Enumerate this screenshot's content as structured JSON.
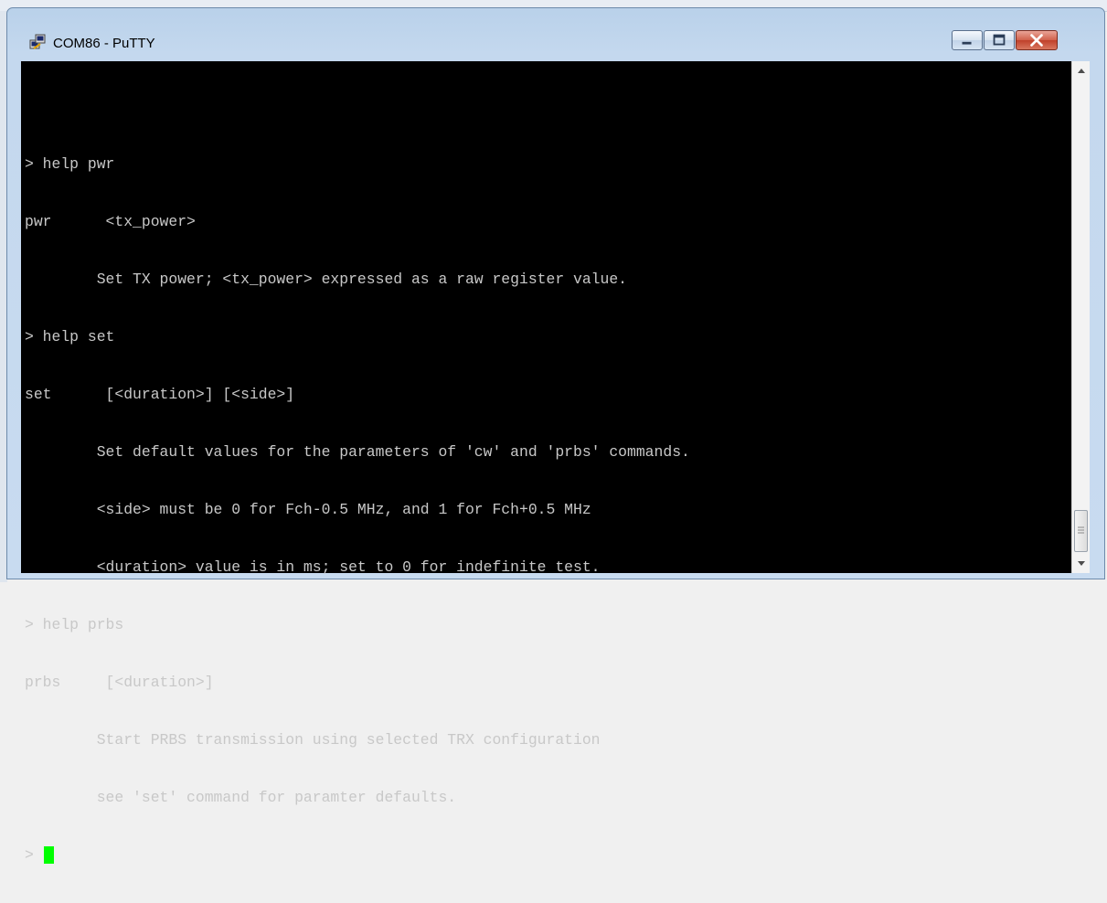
{
  "window": {
    "title": "COM86 - PuTTY"
  },
  "terminal": {
    "lines": [
      "",
      "> help pwr",
      "pwr      <tx_power>",
      "        Set TX power; <tx_power> expressed as a raw register value.",
      "> help set",
      "set      [<duration>] [<side>]",
      "        Set default values for the parameters of 'cw' and 'prbs' commands.",
      "        <side> must be 0 for Fch-0.5 MHz, and 1 for Fch+0.5 MHz",
      "        <duration> value is in ms; set to 0 for indefinite test.",
      "> help prbs",
      "prbs     [<duration>]",
      "        Start PRBS transmission using selected TRX configuration",
      "        see 'set' command for paramter defaults."
    ],
    "prompt": ">",
    "cursor_color": "#00ff00",
    "background_color": "#000000",
    "text_color": "#c8c8c8"
  },
  "icons": {
    "app": "putty-icon",
    "minimize": "minimize-icon",
    "maximize": "maximize-icon",
    "close": "close-icon",
    "scroll_up": "arrow-up-icon",
    "scroll_down": "arrow-down-icon"
  }
}
